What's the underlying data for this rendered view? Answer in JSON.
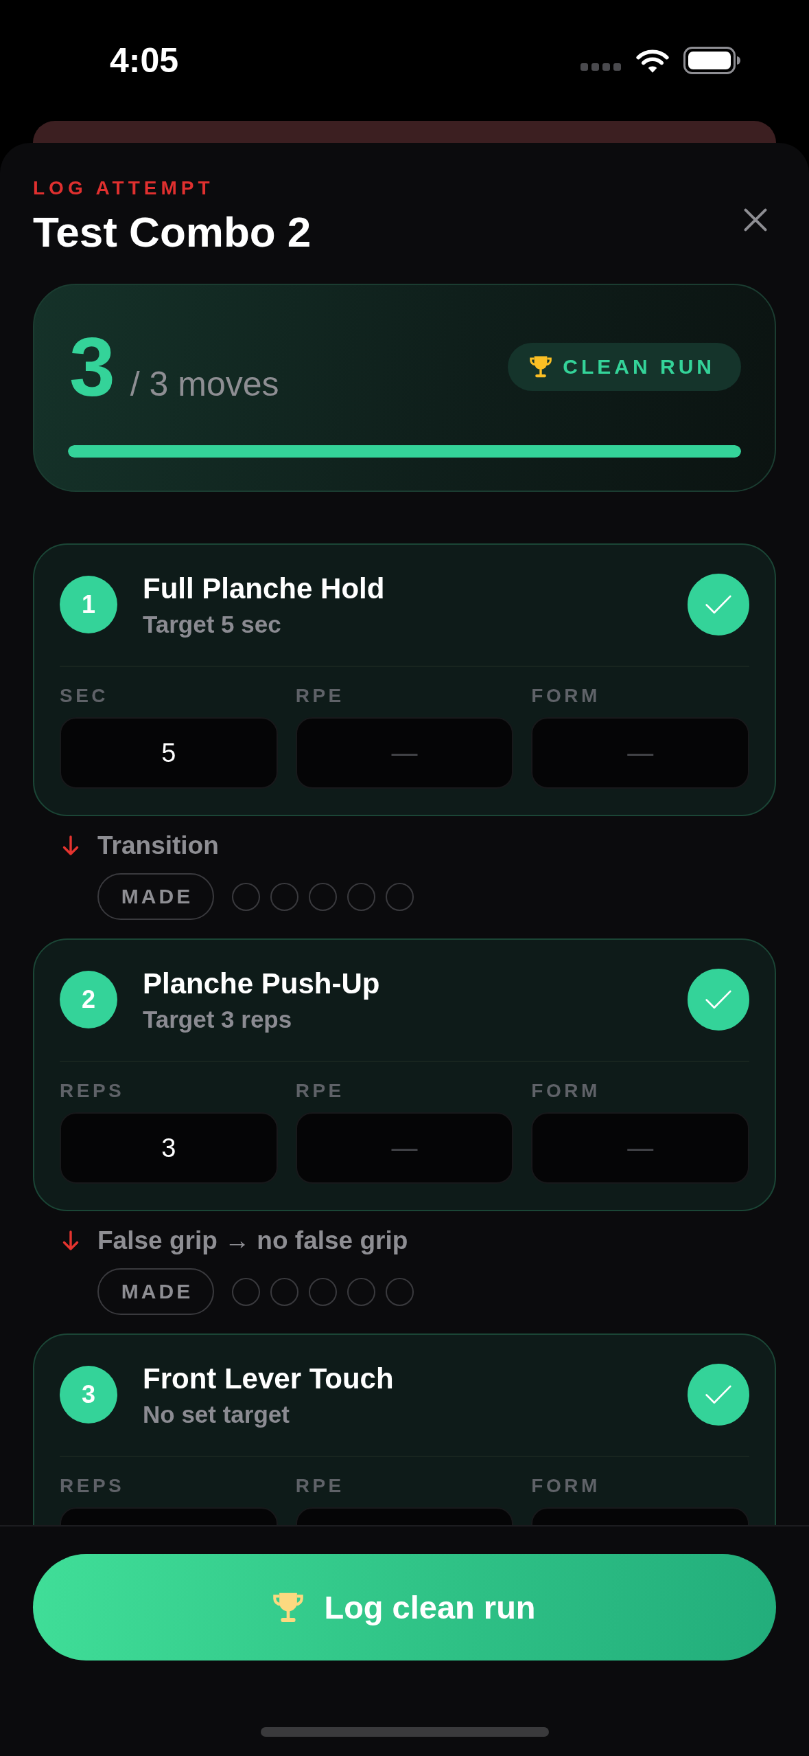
{
  "status_bar": {
    "time": "4:05"
  },
  "header": {
    "eyebrow": "LOG ATTEMPT",
    "title": "Test Combo 2"
  },
  "summary": {
    "count": "3",
    "total": "/ 3 moves",
    "badge": "CLEAN RUN",
    "progress": {
      "level": 1
    }
  },
  "items": [
    {
      "kind": "move",
      "number": "1",
      "name": "Full Planche Hold",
      "target": "Target 5 sec",
      "done": true,
      "fields": [
        {
          "label": "SEC",
          "value": "5"
        },
        {
          "label": "RPE",
          "placeholder": "—"
        },
        {
          "label": "FORM",
          "placeholder": "—"
        }
      ]
    },
    {
      "kind": "transition",
      "text": "Transition",
      "made": {
        "label": "MADE",
        "on": false
      },
      "stars": 0
    },
    {
      "kind": "move",
      "number": "2",
      "name": "Planche Push-Up",
      "target": "Target 3 reps",
      "done": true,
      "fields": [
        {
          "label": "REPS",
          "value": "3"
        },
        {
          "label": "RPE",
          "placeholder": "—"
        },
        {
          "label": "FORM",
          "placeholder": "—"
        }
      ]
    },
    {
      "kind": "transition",
      "text": "False grip → no false grip",
      "made": {
        "label": "MADE",
        "on": false
      },
      "stars": 0
    },
    {
      "kind": "move",
      "number": "3",
      "name": "Front Lever Touch",
      "target": "No set target",
      "done": true,
      "fields": [
        {
          "label": "REPS"
        },
        {
          "label": "RPE"
        },
        {
          "label": "FORM"
        }
      ]
    }
  ],
  "primary_button": {
    "label": "Log clean run"
  }
}
